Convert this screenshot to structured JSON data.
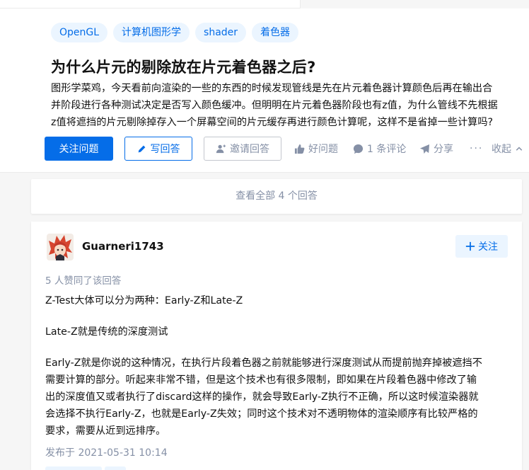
{
  "question": {
    "tags": [
      "OpenGL",
      "计算机图形学",
      "shader",
      "着色器"
    ],
    "title": "为什么片元的剔除放在片元着色器之后?",
    "detail_lines": [
      "图形学菜鸡，今天看前向渲染的一些的东西的时候发现管线是先在片元着色器计算颜色后再在输出合",
      "并阶段进行各种测试决定是否写入颜色缓冲。但明明在片元着色器阶段也有z值，为什么管线不先根据",
      "z值将遮挡的片元剔除掉存入一个屏幕空间的片元缓存再进行颜色计算呢，这样不是省掉一些计算吗?"
    ],
    "actions": {
      "follow": "关注问题",
      "write": "写回答",
      "invite": "邀请回答",
      "like": "好问题",
      "comment": "1 条评论",
      "share": "分享",
      "more": "···",
      "collapse": "收起"
    }
  },
  "view_all": "查看全部 4 个回答",
  "answer": {
    "author": "Guarneri1743",
    "follow": "关注",
    "votes": "5 人赞同了该回答",
    "para1": "Z-Test大体可以分为两种：Early-Z和Late-Z",
    "para2": "Late-Z就是传统的深度测试",
    "para3_lines": [
      "Early-Z就是你说的这种情况，在执行片段着色器之前就能够进行深度测试从而提前抛弃掉被遮挡不",
      "需要计算的部分。听起来非常不错，但是这个技术也有很多限制，即如果在片段着色器中修改了输",
      "出的深度值又或者执行了discard这样的操作，就会导致Early-Z执行不正确，所以这时候渲染器就",
      "会选择不执行Early-Z，也就是Early-Z失效；同时这个技术对不透明物体的渲染顺序有比较严格的",
      "要求，需要从近到远排序。"
    ],
    "published": "发布于 2021-05-31 10:14"
  },
  "colors": {
    "accent": "#056de8",
    "accent_bg": "#ebf5ff",
    "muted": "#8590a6",
    "text": "#121212",
    "page_bg": "#f6f6f6"
  },
  "icons": [
    "pencil-icon",
    "person-icon",
    "thumb-up-icon",
    "comment-bubble-icon",
    "paper-plane-icon",
    "chevron-up-icon",
    "plus-icon"
  ]
}
